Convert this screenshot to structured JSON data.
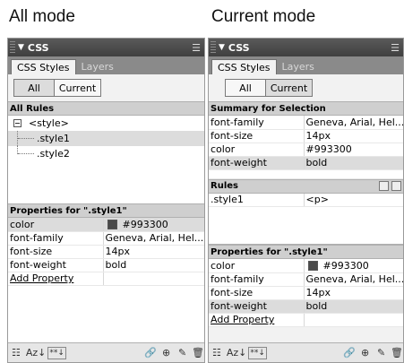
{
  "captions": {
    "left": "All mode",
    "right": "Current mode"
  },
  "panel_title": "CSS",
  "tabs": {
    "styles": "CSS Styles",
    "layers": "Layers"
  },
  "mode_buttons": {
    "all": "All",
    "current": "Current"
  },
  "left": {
    "all_rules_heading": "All Rules",
    "tree": {
      "root": "<style>",
      "items": [
        ".style1",
        ".style2"
      ]
    },
    "properties_heading": "Properties for \".style1\"",
    "properties": [
      {
        "name": "color",
        "value": "#993300",
        "swatch": "#4a4a4a"
      },
      {
        "name": "font-family",
        "value": "Geneva, Arial, Hel..."
      },
      {
        "name": "font-size",
        "value": "14px"
      },
      {
        "name": "font-weight",
        "value": "bold"
      }
    ],
    "add_property": "Add Property"
  },
  "right": {
    "summary_heading": "Summary for Selection",
    "summary": [
      {
        "name": "font-family",
        "value": "Geneva, Arial, Hel..."
      },
      {
        "name": "font-size",
        "value": "14px"
      },
      {
        "name": "color",
        "value": "#993300"
      },
      {
        "name": "font-weight",
        "value": "bold"
      }
    ],
    "rules_heading": "Rules",
    "rules": [
      {
        "selector": ".style1",
        "tag": "<p>"
      }
    ],
    "properties_heading": "Properties for \".style1\"",
    "properties": [
      {
        "name": "color",
        "value": "#993300",
        "swatch": "#4a4a4a"
      },
      {
        "name": "font-family",
        "value": "Geneva, Arial, Hel..."
      },
      {
        "name": "font-size",
        "value": "14px"
      },
      {
        "name": "font-weight",
        "value": "bold"
      }
    ],
    "add_property": "Add Property"
  },
  "bottom_toolbar": {
    "az_label": "Az↓",
    "star_label": "**↓"
  }
}
